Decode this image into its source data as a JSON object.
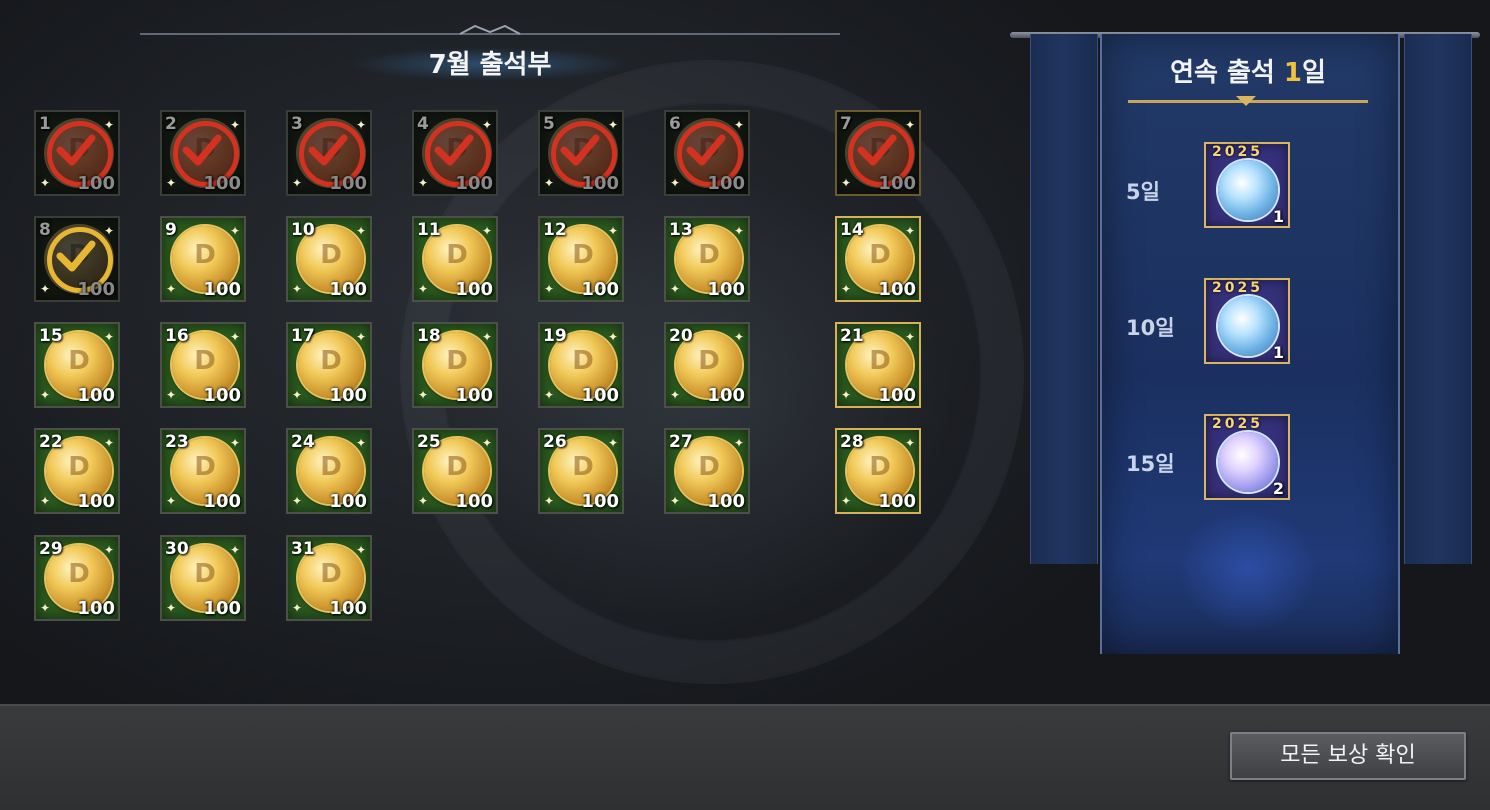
{
  "attendance": {
    "title": "7월 출석부",
    "days": [
      {
        "day": "1",
        "qty": "100",
        "claimed": true,
        "check": "red",
        "highlight": false
      },
      {
        "day": "2",
        "qty": "100",
        "claimed": true,
        "check": "red",
        "highlight": false
      },
      {
        "day": "3",
        "qty": "100",
        "claimed": true,
        "check": "red",
        "highlight": false
      },
      {
        "day": "4",
        "qty": "100",
        "claimed": true,
        "check": "red",
        "highlight": false
      },
      {
        "day": "5",
        "qty": "100",
        "claimed": true,
        "check": "red",
        "highlight": false
      },
      {
        "day": "6",
        "qty": "100",
        "claimed": true,
        "check": "red",
        "highlight": false
      },
      {
        "day": "7",
        "qty": "100",
        "claimed": true,
        "check": "red",
        "highlight": true
      },
      {
        "day": "8",
        "qty": "100",
        "claimed": true,
        "check": "gold",
        "highlight": false
      },
      {
        "day": "9",
        "qty": "100",
        "claimed": false,
        "highlight": false
      },
      {
        "day": "10",
        "qty": "100",
        "claimed": false,
        "highlight": false
      },
      {
        "day": "11",
        "qty": "100",
        "claimed": false,
        "highlight": false
      },
      {
        "day": "12",
        "qty": "100",
        "claimed": false,
        "highlight": false
      },
      {
        "day": "13",
        "qty": "100",
        "claimed": false,
        "highlight": false
      },
      {
        "day": "14",
        "qty": "100",
        "claimed": false,
        "highlight": true
      },
      {
        "day": "15",
        "qty": "100",
        "claimed": false,
        "highlight": false
      },
      {
        "day": "16",
        "qty": "100",
        "claimed": false,
        "highlight": false
      },
      {
        "day": "17",
        "qty": "100",
        "claimed": false,
        "highlight": false
      },
      {
        "day": "18",
        "qty": "100",
        "claimed": false,
        "highlight": false
      },
      {
        "day": "19",
        "qty": "100",
        "claimed": false,
        "highlight": false
      },
      {
        "day": "20",
        "qty": "100",
        "claimed": false,
        "highlight": false
      },
      {
        "day": "21",
        "qty": "100",
        "claimed": false,
        "highlight": true
      },
      {
        "day": "22",
        "qty": "100",
        "claimed": false,
        "highlight": false
      },
      {
        "day": "23",
        "qty": "100",
        "claimed": false,
        "highlight": false
      },
      {
        "day": "24",
        "qty": "100",
        "claimed": false,
        "highlight": false
      },
      {
        "day": "25",
        "qty": "100",
        "claimed": false,
        "highlight": false
      },
      {
        "day": "26",
        "qty": "100",
        "claimed": false,
        "highlight": false
      },
      {
        "day": "27",
        "qty": "100",
        "claimed": false,
        "highlight": false
      },
      {
        "day": "28",
        "qty": "100",
        "claimed": false,
        "highlight": true
      },
      {
        "day": "29",
        "qty": "100",
        "claimed": false,
        "highlight": false
      },
      {
        "day": "30",
        "qty": "100",
        "claimed": false,
        "highlight": false
      },
      {
        "day": "31",
        "qty": "100",
        "claimed": false,
        "highlight": false
      }
    ],
    "reward_icon": "gold-d-coin-icon"
  },
  "streak": {
    "prefix": "연속 출석 ",
    "count": "1",
    "suffix": "일",
    "milestones": [
      {
        "label": "5일",
        "year": "2025",
        "qty": "1",
        "icon": "blue-cat-medal-icon"
      },
      {
        "label": "10일",
        "year": "2025",
        "qty": "1",
        "icon": "blue-cat-medal-icon"
      },
      {
        "label": "15일",
        "year": "2025",
        "qty": "2",
        "icon": "violet-cat-medal-icon"
      }
    ]
  },
  "footer": {
    "all_rewards_label": "모든 보상 확인"
  },
  "colors": {
    "cell_green": "#2b5a1f",
    "highlight_gold": "#d7b15a",
    "check_red": "#d2321f",
    "check_gold": "#e7b632",
    "streak_accent": "#f0c23c",
    "banner_blue": "#1b3060"
  }
}
